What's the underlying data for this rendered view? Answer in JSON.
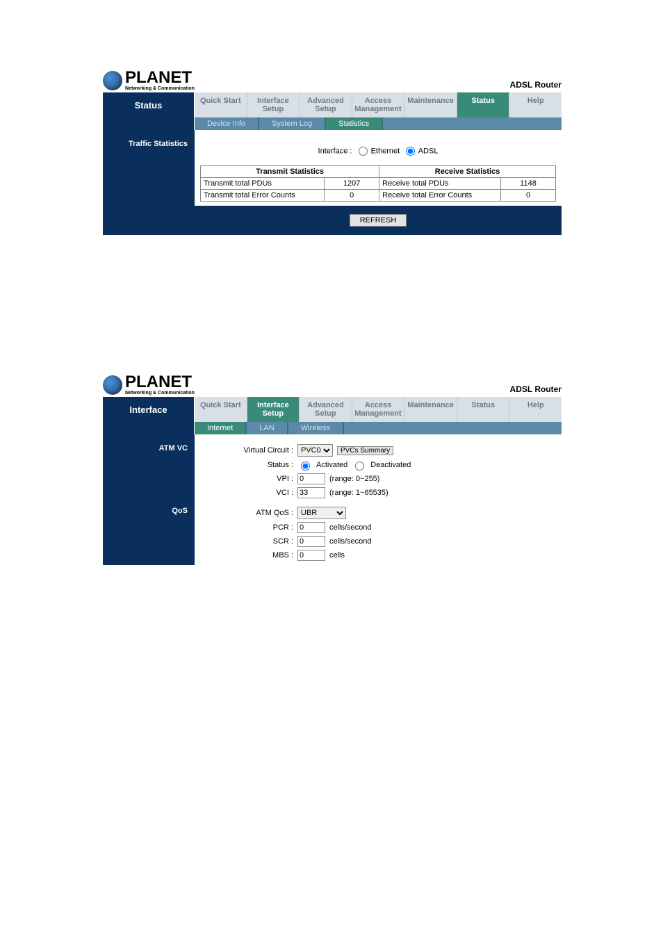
{
  "brand": {
    "name": "PLANET",
    "tag": "Networking & Communication",
    "product": "ADSL Router"
  },
  "block1": {
    "side_title": "Status",
    "nav": [
      "Quick Start",
      "Interface Setup",
      "Advanced Setup",
      "Access Management",
      "Maintenance",
      "Status",
      "Help"
    ],
    "nav_active": 5,
    "subnav": [
      "Device Info",
      "System Log",
      "Statistics"
    ],
    "subnav_active": 2,
    "section_label": "Traffic Statistics",
    "iface_label": "Interface :",
    "iface_opts": [
      "Ethernet",
      "ADSL"
    ],
    "iface_sel": 1,
    "stats": {
      "tx_header": "Transmit Statistics",
      "rx_header": "Receive Statistics",
      "rows": [
        {
          "tx_label": "Transmit total PDUs",
          "tx_val": "1207",
          "rx_label": "Receive total PDUs",
          "rx_val": "1148"
        },
        {
          "tx_label": "Transmit total Error Counts",
          "tx_val": "0",
          "rx_label": "Receive total Error Counts",
          "rx_val": "0"
        }
      ]
    },
    "refresh": "REFRESH"
  },
  "block2": {
    "side_title": "Interface",
    "nav": [
      "Quick Start",
      "Interface Setup",
      "Advanced Setup",
      "Access Management",
      "Maintenance",
      "Status",
      "Help"
    ],
    "nav_active": 1,
    "subnav": [
      "Internet",
      "LAN",
      "Wireless"
    ],
    "subnav_active": 0,
    "section_atmvc": "ATM VC",
    "section_qos": "QoS",
    "vc": {
      "label": "Virtual Circuit :",
      "value": "PVC0",
      "summary_btn": "PVCs Summary",
      "status_label": "Status :",
      "status_opts": [
        "Activated",
        "Deactivated"
      ],
      "status_sel": 0,
      "vpi_label": "VPI :",
      "vpi_val": "0",
      "vpi_hint": "(range: 0~255)",
      "vci_label": "VCI :",
      "vci_val": "33",
      "vci_hint": "(range: 1~65535)"
    },
    "qos": {
      "atmqos_label": "ATM QoS :",
      "atmqos_val": "UBR",
      "pcr_label": "PCR :",
      "pcr_val": "0",
      "pcr_hint": "cells/second",
      "scr_label": "SCR :",
      "scr_val": "0",
      "scr_hint": "cells/second",
      "mbs_label": "MBS :",
      "mbs_val": "0",
      "mbs_hint": "cells"
    }
  }
}
